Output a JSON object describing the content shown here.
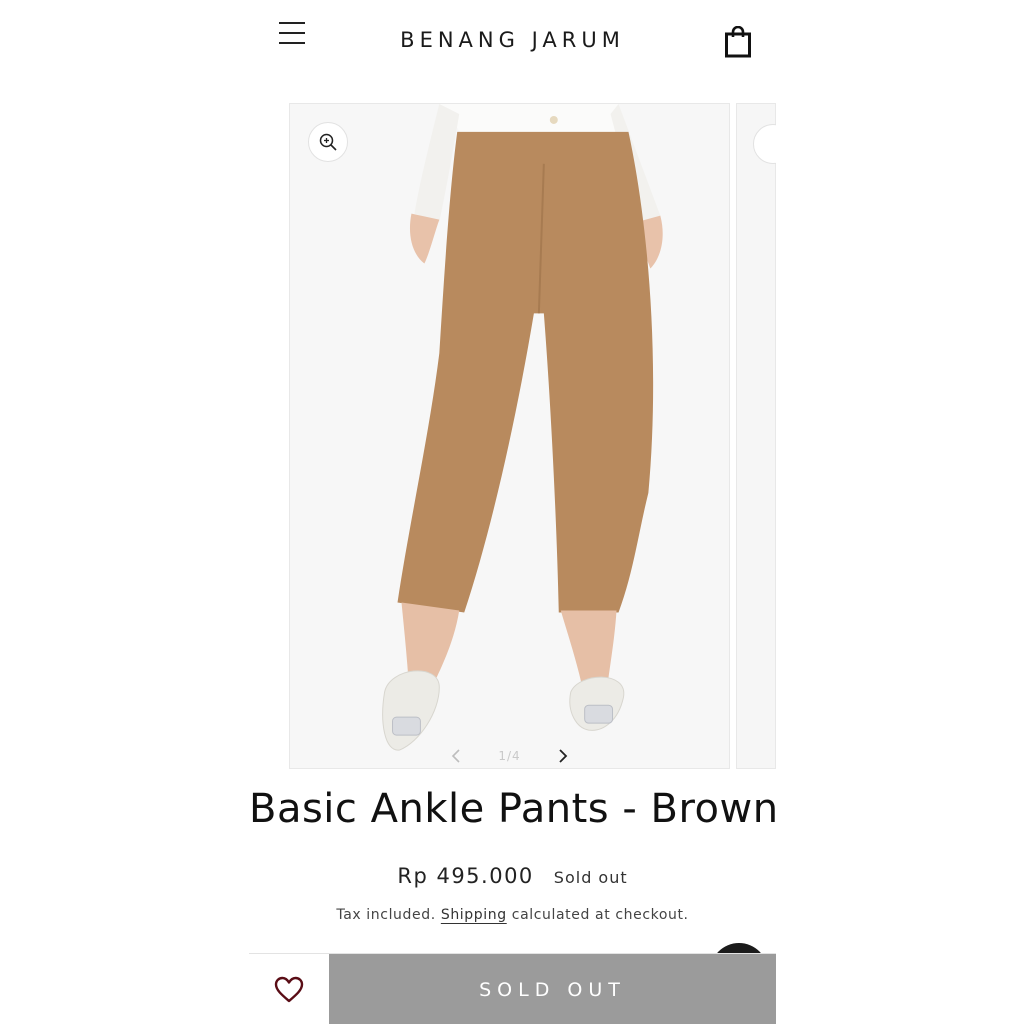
{
  "header": {
    "brand": "BENANG JARUM",
    "menu_icon": "hamburger-menu-icon",
    "cart_icon": "shopping-bag-icon"
  },
  "gallery": {
    "counter": "1/4",
    "prev_icon": "chevron-left-icon",
    "next_icon": "chevron-right-icon",
    "zoom_icon": "zoom-in-icon",
    "product_color": "#b88a5e"
  },
  "product": {
    "title": "Basic Ankle Pants - Brown",
    "price": "Rp 495.000",
    "status": "Sold out",
    "tax_prefix": "Tax included.",
    "shipping_link": "Shipping",
    "tax_suffix": "calculated at checkout."
  },
  "actions": {
    "sold_out_button": "SOLD OUT",
    "wishlist_icon": "heart-icon",
    "chat_icon": "chat-icon"
  },
  "colors": {
    "sold_out_bg": "#9b9b9b",
    "heart": "#5a0d16"
  }
}
